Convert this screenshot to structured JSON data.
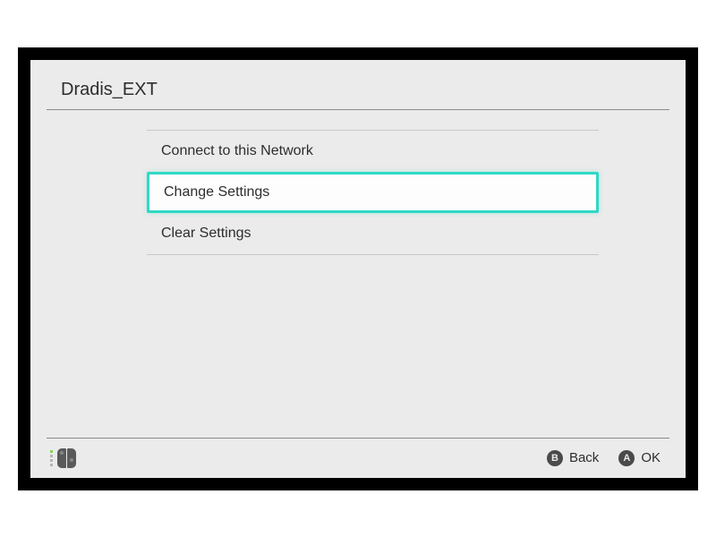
{
  "header": {
    "title": "Dradis_EXT"
  },
  "menu": {
    "items": [
      {
        "label": "Connect to this Network",
        "selected": false
      },
      {
        "label": "Change Settings",
        "selected": true
      },
      {
        "label": "Clear Settings",
        "selected": false
      }
    ]
  },
  "footer": {
    "back": {
      "button": "B",
      "label": "Back"
    },
    "ok": {
      "button": "A",
      "label": "OK"
    }
  }
}
